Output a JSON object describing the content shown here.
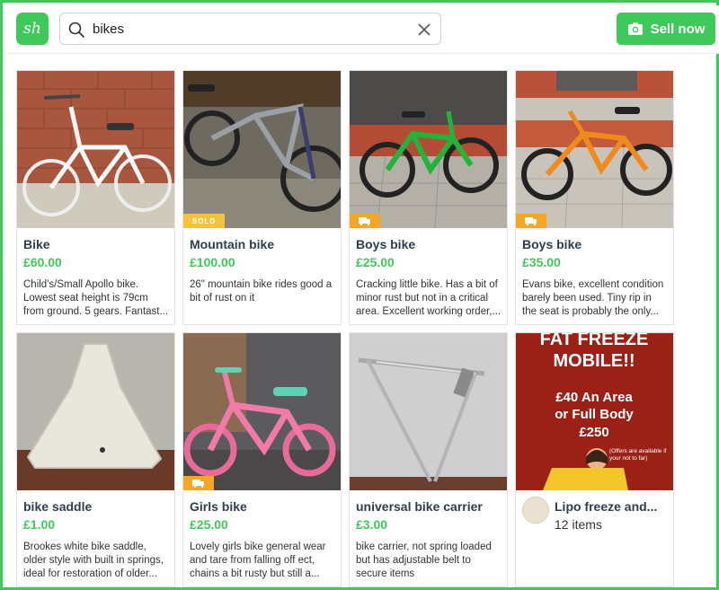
{
  "header": {
    "logo_text": "sh",
    "search": {
      "value": "bikes",
      "placeholder": ""
    },
    "sell_label": "Sell now"
  },
  "listings": [
    {
      "title": "Bike",
      "price": "£60.00",
      "desc": "Child's/Small Apollo bike. Lowest seat height is 79cm from ground. 5 gears. Fantast...",
      "badge": ""
    },
    {
      "title": "Mountain bike",
      "price": "£100.00",
      "desc": "26\" mountain bike rides good a bit of rust on it",
      "badge": "SOLD"
    },
    {
      "title": "Boys bike",
      "price": "£25.00",
      "desc": "Cracking little bike. Has a bit of minor rust but not in a critical area. Excellent working order,...",
      "badge": "van"
    },
    {
      "title": "Boys bike",
      "price": "£35.00",
      "desc": "Evans bike, excellent condition barely been used. Tiny rip in the seat is probably the only...",
      "badge": "van"
    },
    {
      "title": "bike saddle",
      "price": "£1.00",
      "desc": "Brookes white bike saddle, older style with built in springs, ideal for restoration of older...",
      "badge": ""
    },
    {
      "title": "Girls bike",
      "price": "£25.00",
      "desc": "Lovely girls bike general wear and tare from falling off ect, chains a bit rusty but still a...",
      "badge": "van"
    },
    {
      "title": "universal bike carrier",
      "price": "£3.00",
      "desc": "bike carrier, not spring loaded but has adjustable belt to secure items",
      "badge": ""
    }
  ],
  "promo": {
    "lines": [
      "FAT FREEZE",
      "MOBILE!!",
      "£40 An Area",
      "or Full Body",
      "£250"
    ],
    "note": "(Offers are available if your not to far)",
    "seller": "Lipo freeze and...",
    "items": "12 items"
  },
  "colors": {
    "brand": "#3ec95a",
    "title": "#2d3e50",
    "sold": "#f4c33b",
    "van": "#f5a623",
    "promo_bg": "#9b2016"
  }
}
